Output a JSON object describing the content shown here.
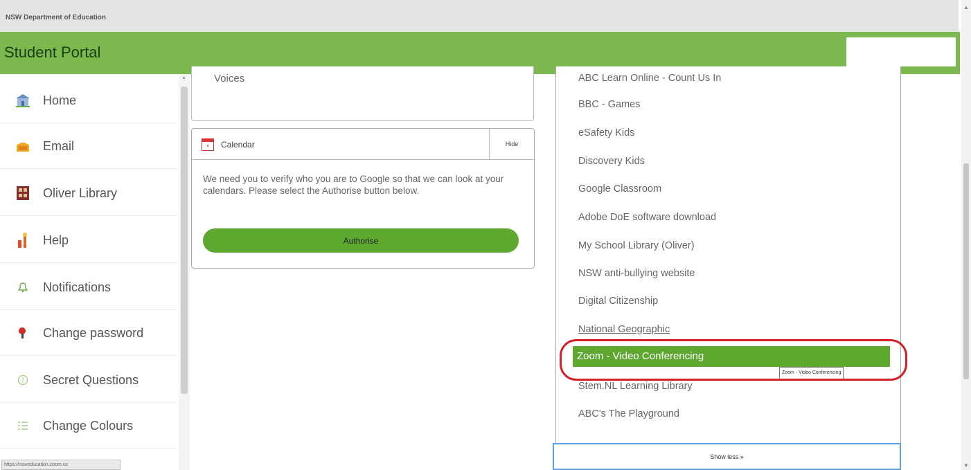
{
  "topbar": {
    "dept": "NSW Department of Education"
  },
  "header": {
    "title": "Student Portal",
    "search_placeholder": ""
  },
  "sidebar": {
    "items": [
      {
        "label": "Home",
        "icon": "school-building-icon"
      },
      {
        "label": "Email",
        "icon": "mailbox-icon"
      },
      {
        "label": "Oliver Library",
        "icon": "book-icon"
      },
      {
        "label": "Help",
        "icon": "help-icon"
      },
      {
        "label": "Notifications",
        "icon": "bell-icon"
      },
      {
        "label": "Change password",
        "icon": "key-icon"
      },
      {
        "label": "Secret Questions",
        "icon": "question-circle-icon"
      },
      {
        "label": "Change Colours",
        "icon": "palette-icon"
      }
    ]
  },
  "status_url": "https://nsweducation.zoom.us",
  "voices": {
    "text": "Voices"
  },
  "calendar": {
    "title": "Calendar",
    "hide_label": "Hide",
    "message": "We need you to verify who you are to Google so that we can look at your calendars. Please select the Authorise button below.",
    "authorise_label": "Authorise"
  },
  "links": {
    "partial_top": "ABC Learn Online - Count Us In",
    "items": [
      "BBC - Games",
      "eSafety Kids",
      "Discovery Kids",
      "Google Classroom",
      "Adobe DoE software download",
      "My School Library (Oliver)",
      "NSW anti-bullying website",
      "Digital Citizenship",
      "National Geographic"
    ],
    "highlighted": "Zoom - Video Conferencing",
    "after": [
      "Stem.NL Learning Library",
      "ABC's The Playground"
    ],
    "tooltip": "Zoom - Video Conferencing",
    "show_less": "Show less »"
  },
  "colors": {
    "brand_green": "#7bb84e",
    "button_green": "#5ea830",
    "annotation_red": "#d41f26"
  }
}
